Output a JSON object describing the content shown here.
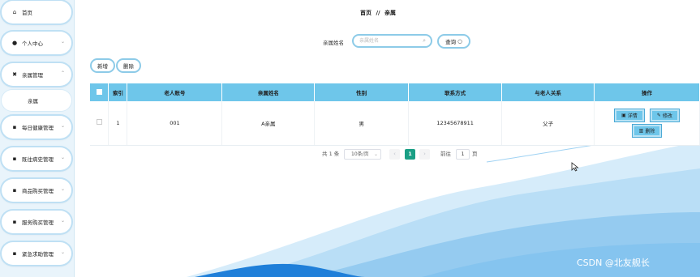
{
  "sidebar": {
    "items": [
      {
        "icon": "home-icon",
        "label": "首页",
        "has_chevron": false
      },
      {
        "icon": "user-icon",
        "label": "个人中心",
        "has_chevron": true
      },
      {
        "icon": "family-icon",
        "label": "亲属管理",
        "has_chevron": true,
        "expanded": true
      },
      {
        "icon": "grid-icon",
        "label": "每日健康管理",
        "has_chevron": true
      },
      {
        "icon": "grid-icon",
        "label": "既往病史管理",
        "has_chevron": true
      },
      {
        "icon": "grid-icon",
        "label": "商品购买管理",
        "has_chevron": true
      },
      {
        "icon": "grid-icon",
        "label": "服务购买管理",
        "has_chevron": true
      },
      {
        "icon": "grid-icon",
        "label": "紧急求助管理",
        "has_chevron": true
      }
    ],
    "sub_item": "亲属"
  },
  "breadcrumb": {
    "home": "首页",
    "sep": "//",
    "current": "亲属"
  },
  "search": {
    "label": "亲属姓名",
    "placeholder": "亲属姓名",
    "button": "查询"
  },
  "actions": {
    "add": "新增",
    "delete": "删除"
  },
  "table": {
    "headers": [
      "索引",
      "老人账号",
      "亲属姓名",
      "性别",
      "联系方式",
      "与老人关系",
      "操作"
    ],
    "rows": [
      {
        "index": "1",
        "account": "001",
        "name": "A亲属",
        "gender": "男",
        "phone": "12345678911",
        "relation": "父子"
      }
    ],
    "row_buttons": {
      "detail": "详情",
      "edit": "修改",
      "delete": "删除"
    }
  },
  "pager": {
    "total": "共 1 条",
    "page_size": "10条/页",
    "current": "1",
    "goto_label": "前往",
    "goto_value": "1",
    "page_unit": "页"
  },
  "watermark": "CSDN @北友舰长",
  "colors": {
    "header_bg": "#6ec6ea",
    "accent": "#1a9f85",
    "pill_border": "#8dcbe8"
  }
}
